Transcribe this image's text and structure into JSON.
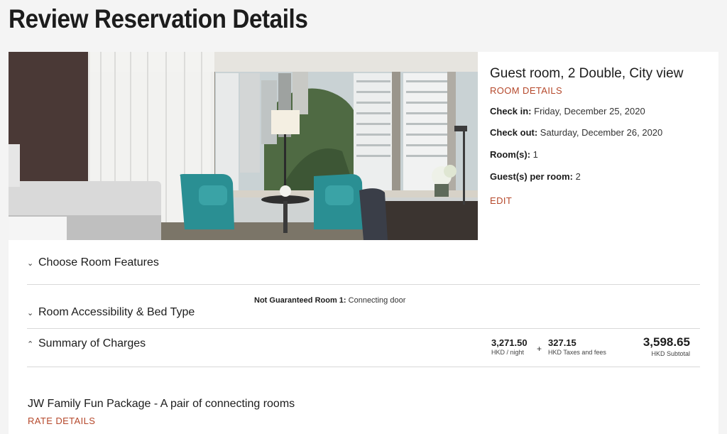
{
  "page": {
    "title": "Review Reservation Details"
  },
  "room": {
    "name": "Guest room, 2 Double, City view",
    "details_link": "ROOM DETAILS",
    "checkin_label": "Check in:",
    "checkin_value": "Friday, December 25, 2020",
    "checkout_label": "Check out:",
    "checkout_value": "Saturday, December 26, 2020",
    "rooms_label": "Room(s):",
    "rooms_value": "1",
    "guests_label": "Guest(s) per room:",
    "guests_value": "2",
    "edit_link": "EDIT"
  },
  "sections": {
    "room_features": {
      "label": "Choose Room Features",
      "icon": "chevron-down-icon"
    },
    "accessibility": {
      "label": "Room Accessibility & Bed Type",
      "icon": "chevron-down-icon",
      "note_label": "Not Guaranteed Room 1:",
      "note_value": "Connecting door"
    },
    "charges": {
      "label": "Summary of Charges",
      "icon": "chevron-up-icon",
      "nightly_amount": "3,271.50",
      "nightly_unit": "HKD / night",
      "plus": "+",
      "taxes_amount": "327.15",
      "taxes_unit": "HKD Taxes and fees",
      "subtotal_amount": "3,598.65",
      "subtotal_unit": "HKD Subtotal"
    }
  },
  "package": {
    "title": "JW Family Fun Package - A pair of connecting rooms",
    "rate_link": "RATE DETAILS"
  },
  "colors": {
    "accent_link": "#b5482b",
    "background": "#f4f4f4",
    "card": "#ffffff",
    "divider": "#d9d9d9"
  }
}
